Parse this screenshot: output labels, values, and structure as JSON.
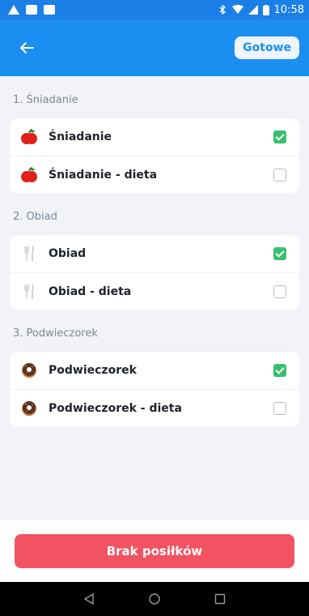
{
  "status_bar": {
    "time": "10:58"
  },
  "header": {
    "done_label": "Gotowe"
  },
  "sections": [
    {
      "title": "1. Śniadanie",
      "items": [
        {
          "label": "Śniadanie",
          "icon": "apple-icon",
          "checked": true
        },
        {
          "label": "Śniadanie - dieta",
          "icon": "apple-icon",
          "checked": false
        }
      ]
    },
    {
      "title": "2. Obiad",
      "items": [
        {
          "label": "Obiad",
          "icon": "fork-knife-icon",
          "checked": true
        },
        {
          "label": "Obiad - dieta",
          "icon": "fork-knife-icon",
          "checked": false
        }
      ]
    },
    {
      "title": "3. Podwieczorek",
      "items": [
        {
          "label": "Podwieczorek",
          "icon": "donut-icon",
          "checked": true
        },
        {
          "label": "Podwieczorek - dieta",
          "icon": "donut-icon",
          "checked": false
        }
      ]
    }
  ],
  "footer": {
    "no_meals_label": "Brak posiłków"
  },
  "colors": {
    "primary": "#1b8ef2",
    "check": "#39c06f",
    "danger": "#f25362"
  }
}
